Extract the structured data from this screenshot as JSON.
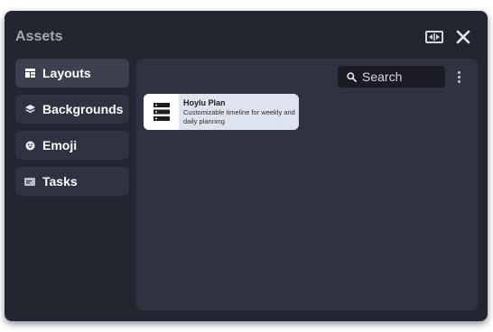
{
  "header": {
    "title": "Assets",
    "fit_icon": "fit-width-icon",
    "close_icon": "close-icon"
  },
  "sidebar": {
    "items": [
      {
        "label": "Layouts",
        "icon": "layout-icon",
        "active": true
      },
      {
        "label": "Backgrounds",
        "icon": "layers-icon",
        "active": false
      },
      {
        "label": "Emoji",
        "icon": "emoji-icon",
        "active": false
      },
      {
        "label": "Tasks",
        "icon": "card-icon",
        "active": false
      }
    ]
  },
  "main": {
    "search": {
      "placeholder": "Search",
      "value": ""
    },
    "more_icon": "more-vertical-icon",
    "cards": [
      {
        "name": "Hoylu Plan",
        "description": "Customizable timeline for weekly and daily planning",
        "icon": "timeline-plan-icon"
      }
    ]
  },
  "colors": {
    "dialog_bg": "#232530",
    "panel_bg": "#2f3240",
    "active_item_bg": "#3d404e",
    "card_bg": "#dde4ef",
    "search_bg": "#1a1b23"
  }
}
